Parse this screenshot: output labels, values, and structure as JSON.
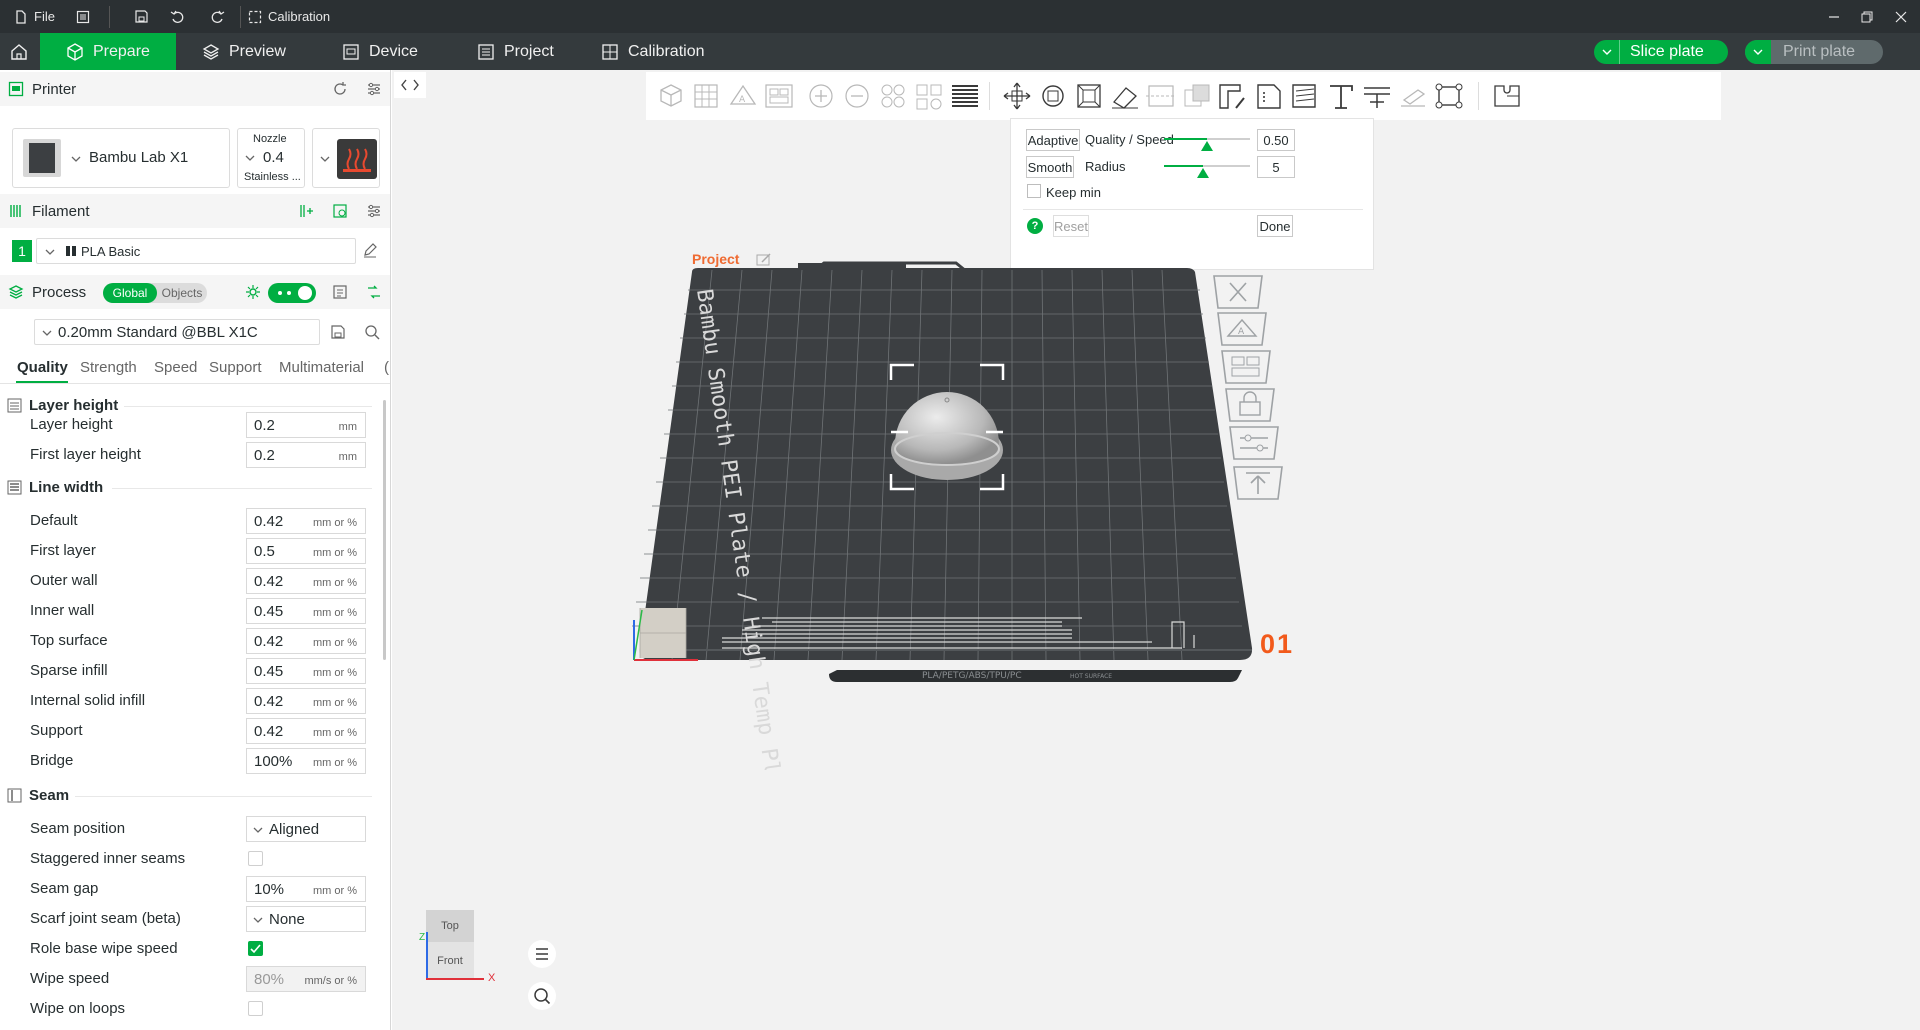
{
  "titlebar": {
    "file_label": "File",
    "calibration_label": "Calibration"
  },
  "nav": {
    "tabs": [
      {
        "label": "Prepare"
      },
      {
        "label": "Preview"
      },
      {
        "label": "Device"
      },
      {
        "label": "Project"
      },
      {
        "label": "Calibration"
      }
    ],
    "slice_label": "Slice plate",
    "print_label": "Print plate"
  },
  "printer": {
    "section_title": "Printer",
    "name": "Bambu Lab X1",
    "nozzle_caption": "Nozzle",
    "nozzle_value": "0.4",
    "nozzle_type": "Stainless ..."
  },
  "filament": {
    "section_title": "Filament",
    "slot_number": "1",
    "name": "PLA Basic"
  },
  "process": {
    "section_title": "Process",
    "toggle_global": "Global",
    "toggle_objects": "Objects",
    "preset": "0.20mm Standard @BBL X1C",
    "tabs": [
      "Quality",
      "Strength",
      "Speed",
      "Support",
      "Multimaterial"
    ]
  },
  "settings": {
    "layer_height_group": "Layer height",
    "layer_height": {
      "label": "Layer height",
      "value": "0.2",
      "unit": "mm"
    },
    "first_layer_height": {
      "label": "First layer height",
      "value": "0.2",
      "unit": "mm"
    },
    "line_width_group": "Line width",
    "line_widths": [
      {
        "label": "Default",
        "value": "0.42",
        "unit": "mm or %"
      },
      {
        "label": "First layer",
        "value": "0.5",
        "unit": "mm or %"
      },
      {
        "label": "Outer wall",
        "value": "0.42",
        "unit": "mm or %"
      },
      {
        "label": "Inner wall",
        "value": "0.45",
        "unit": "mm or %"
      },
      {
        "label": "Top surface",
        "value": "0.42",
        "unit": "mm or %"
      },
      {
        "label": "Sparse infill",
        "value": "0.45",
        "unit": "mm or %"
      },
      {
        "label": "Internal solid infill",
        "value": "0.42",
        "unit": "mm or %"
      },
      {
        "label": "Support",
        "value": "0.42",
        "unit": "mm or %"
      },
      {
        "label": "Bridge",
        "value": "100%",
        "unit": "mm or %"
      }
    ],
    "seam_group": "Seam",
    "seam_position": {
      "label": "Seam position",
      "value": "Aligned"
    },
    "staggered": {
      "label": "Staggered inner seams",
      "checked": false
    },
    "seam_gap": {
      "label": "Seam gap",
      "value": "10%",
      "unit": "mm or %"
    },
    "scarf": {
      "label": "Scarf joint seam (beta)",
      "value": "None"
    },
    "role_wipe": {
      "label": "Role base wipe speed",
      "checked": true
    },
    "wipe_speed": {
      "label": "Wipe speed",
      "value": "80%",
      "unit": "mm/s or %"
    },
    "wipe_loops": {
      "label": "Wipe on loops",
      "checked": false
    }
  },
  "adaptive_popup": {
    "adaptive_label": "Adaptive",
    "quality_speed_label": "Quality / Speed",
    "quality_speed_value": "0.50",
    "smooth_label": "Smooth",
    "radius_label": "Radius",
    "radius_value": "5",
    "keep_min_label": "Keep min",
    "reset_label": "Reset",
    "done_label": "Done",
    "help_glyph": "?"
  },
  "plate": {
    "project_label": "Project",
    "plate_title": "Bambu Smooth PEI Plate / High Temp Plate",
    "plate_number": "01",
    "materials_label": "PLA/PETG/ABS/TPU/PC",
    "hot_surface_label": "HOT SURFACE"
  },
  "view_cube": {
    "top_label": "Top",
    "front_label": "Front",
    "axis_z": "Z",
    "axis_x": "X"
  },
  "colors": {
    "accent": "#00ae42",
    "navbar": "#343a3d",
    "titlebar": "#2b3033",
    "plate": "#3c3f42",
    "plate_number": "#f25a1b"
  }
}
